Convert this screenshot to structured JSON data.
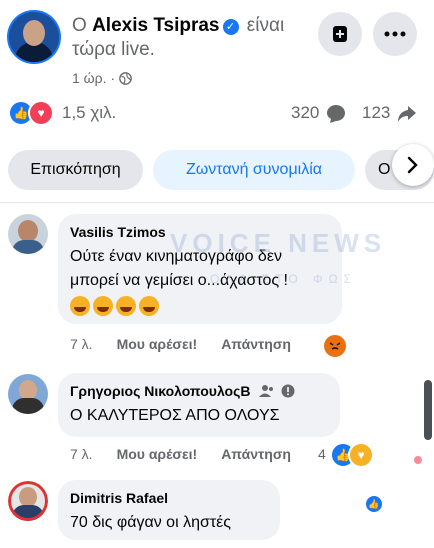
{
  "header": {
    "prefix": "Ο",
    "author": "Alexis Tsipras",
    "status": "είναι τώρα live.",
    "time": "1 ώρ.",
    "dot": "·"
  },
  "stats": {
    "reactions_count": "1,5 χιλ.",
    "comments_count": "320",
    "shares_count": "123"
  },
  "tabs": {
    "overview": "Επισκόπηση",
    "live_chat": "Ζωντανή συνομιλία",
    "partial": "Ο"
  },
  "watermark": {
    "main": "VOICE NEWS",
    "sub": "ΟΛΑ ΣΤΟ ΦΩΣ"
  },
  "comments": [
    {
      "name": "Vasilis Tzimos",
      "text": "Ούτε έναν κινηματογράφο δεν μπορεί να γεμίσει ο...άχαστος !",
      "age": "7 λ.",
      "like": "Μου αρέσει!",
      "reply": "Απάντηση"
    },
    {
      "name": "Γρηγοριος ΝικολοπουλοςΒ",
      "text": "Ο ΚΑΛΥΤΕΡΟΣ ΑΠΟ ΟΛΟΥΣ",
      "age": "7 λ.",
      "like": "Μου αρέσει!",
      "reply": "Απάντηση",
      "reaction_count": "4"
    },
    {
      "name": "Dimitris Rafael",
      "text": "70 δις φάγαν οι ληστές"
    }
  ],
  "colors": {
    "accent": "#1877f2",
    "like_blue": "#1877f2",
    "love_red": "#f33e58",
    "angry": "#e9710f"
  }
}
